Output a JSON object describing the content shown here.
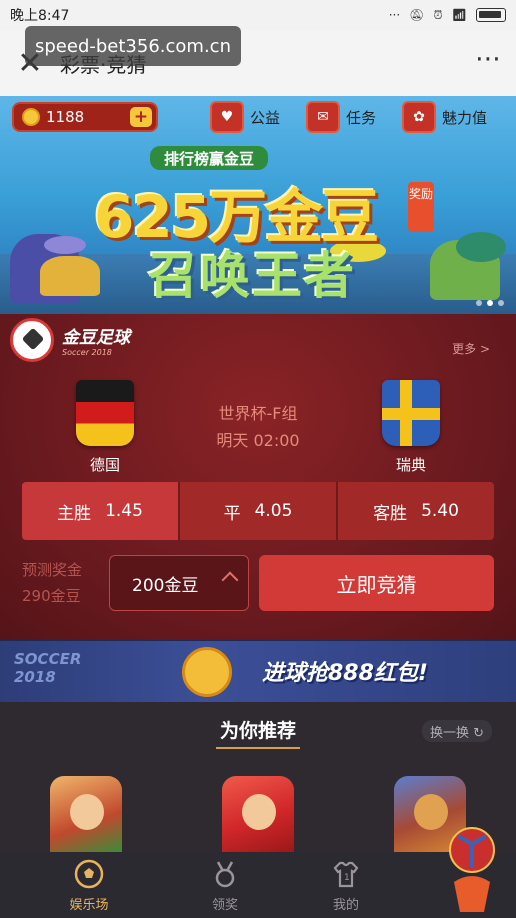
{
  "status_bar": {
    "time": "晚上8:47"
  },
  "watermark": "speed-bet356.com.cn",
  "titlebar": {
    "title": "彩票·竞猜",
    "close_icon": "close-icon",
    "more_icon": "more-icon"
  },
  "banner": {
    "coins": "1188",
    "links": [
      {
        "label": "公益",
        "icon": "charity-icon"
      },
      {
        "label": "任务",
        "icon": "task-icon"
      },
      {
        "label": "魅力值",
        "icon": "flower-icon"
      }
    ],
    "subtitle": "排行榜赢金豆",
    "headline": "625万金豆",
    "badge": "奖励",
    "headline2": "召唤王者"
  },
  "match": {
    "brand_title": "金豆足球",
    "brand_sub": "Soccer 2018",
    "more": "更多 >",
    "home_team": "德国",
    "away_team": "瑞典",
    "league": "世界杯-F组",
    "time": "明天 02:00",
    "odds": [
      {
        "label": "主胜",
        "value": "1.45"
      },
      {
        "label": "平",
        "value": "4.05"
      },
      {
        "label": "客胜",
        "value": "5.40"
      }
    ],
    "predict_label": "预测奖金",
    "predict_value": "290金豆",
    "bet_amount": "200金豆",
    "bet_button": "立即竞猜"
  },
  "promo": {
    "soccer_line1": "SOCCER",
    "soccer_line2": "2018",
    "text": "进球抢888红包!"
  },
  "recommend": {
    "title": "为你推荐",
    "swap": "换一换 ↻"
  },
  "nav": [
    {
      "label": "娱乐场",
      "icon": "soccer-ball-icon"
    },
    {
      "label": "领奖",
      "icon": "medal-icon"
    },
    {
      "label": "我的",
      "icon": "jersey-icon"
    }
  ],
  "colors": {
    "accent": "#d23a38",
    "nav_active": "#e9b35e"
  }
}
